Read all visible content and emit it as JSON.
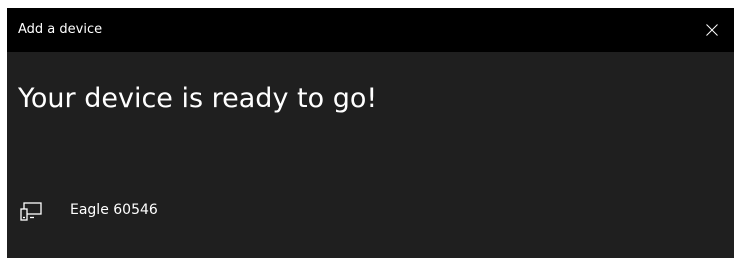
{
  "window": {
    "title": "Add a device",
    "close_icon": "close-icon"
  },
  "main": {
    "headline": "Your device is ready to go!",
    "device": {
      "name": "Eagle 60546",
      "icon": "device-pairing-icon"
    }
  },
  "colors": {
    "titlebar_bg": "#000000",
    "window_bg": "#1f1f1f",
    "text": "#ffffff"
  }
}
